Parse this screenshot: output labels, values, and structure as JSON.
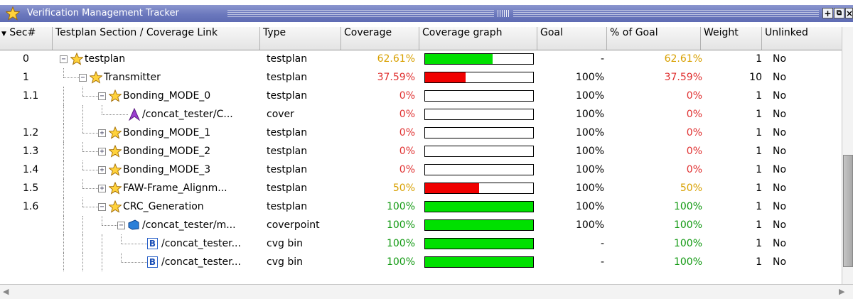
{
  "window": {
    "title": "Verification Management Tracker",
    "buttons": {
      "add": "+",
      "restore": "⧉",
      "close": "×"
    }
  },
  "colors": {
    "title_bar": "#6b78bd",
    "bar_green": "#00e000",
    "bar_red": "#f00000",
    "pct_low": "#e03030",
    "pct_mid": "#d8a000",
    "pct_full": "#119911"
  },
  "table": {
    "columns": [
      "Sec#",
      "Testplan Section / Coverage Link",
      "Type",
      "Coverage",
      "Coverage graph",
      "Goal",
      "% of Goal",
      "Weight",
      "Unlinked"
    ],
    "rows": [
      {
        "sec": "0",
        "name": "testplan",
        "icon": "star-icon",
        "type": "testplan",
        "coverage": "62.61%",
        "coverage_value": 62.61,
        "goal": "-",
        "pct_goal": "62.61%",
        "weight": "1",
        "unlinked": "No",
        "level": "mid",
        "bar": "green"
      },
      {
        "sec": "1",
        "name": "Transmitter",
        "icon": "star-icon",
        "type": "testplan",
        "coverage": "37.59%",
        "coverage_value": 37.59,
        "goal": "100%",
        "pct_goal": "37.59%",
        "weight": "10",
        "unlinked": "No",
        "level": "low",
        "bar": "red"
      },
      {
        "sec": "1.1",
        "name": "Bonding_MODE_0",
        "icon": "star-icon",
        "type": "testplan",
        "coverage": "0%",
        "coverage_value": 0,
        "goal": "100%",
        "pct_goal": "0%",
        "weight": "1",
        "unlinked": "No",
        "level": "low",
        "bar": "red"
      },
      {
        "sec": "",
        "name": "/concat_tester/C...",
        "icon": "cover-icon",
        "type": "cover",
        "coverage": "0%",
        "coverage_value": 0,
        "goal": "100%",
        "pct_goal": "0%",
        "weight": "1",
        "unlinked": "No",
        "level": "low",
        "bar": "red"
      },
      {
        "sec": "1.2",
        "name": "Bonding_MODE_1",
        "icon": "star-icon",
        "type": "testplan",
        "coverage": "0%",
        "coverage_value": 0,
        "goal": "100%",
        "pct_goal": "0%",
        "weight": "1",
        "unlinked": "No",
        "level": "low",
        "bar": "red"
      },
      {
        "sec": "1.3",
        "name": "Bonding_MODE_2",
        "icon": "star-icon",
        "type": "testplan",
        "coverage": "0%",
        "coverage_value": 0,
        "goal": "100%",
        "pct_goal": "0%",
        "weight": "1",
        "unlinked": "No",
        "level": "low",
        "bar": "red"
      },
      {
        "sec": "1.4",
        "name": "Bonding_MODE_3",
        "icon": "star-icon",
        "type": "testplan",
        "coverage": "0%",
        "coverage_value": 0,
        "goal": "100%",
        "pct_goal": "0%",
        "weight": "1",
        "unlinked": "No",
        "level": "low",
        "bar": "red"
      },
      {
        "sec": "1.5",
        "name": "FAW-Frame_Alignm...",
        "icon": "star-icon",
        "type": "testplan",
        "coverage": "50%",
        "coverage_value": 50,
        "goal": "100%",
        "pct_goal": "50%",
        "weight": "1",
        "unlinked": "No",
        "level": "mid",
        "bar": "red"
      },
      {
        "sec": "1.6",
        "name": "CRC_Generation",
        "icon": "star-icon",
        "type": "testplan",
        "coverage": "100%",
        "coverage_value": 100,
        "goal": "100%",
        "pct_goal": "100%",
        "weight": "1",
        "unlinked": "No",
        "level": "full",
        "bar": "green"
      },
      {
        "sec": "",
        "name": "/concat_tester/m...",
        "icon": "coverpoint-icon",
        "type": "coverpoint",
        "coverage": "100%",
        "coverage_value": 100,
        "goal": "100%",
        "pct_goal": "100%",
        "weight": "1",
        "unlinked": "No",
        "level": "full",
        "bar": "green"
      },
      {
        "sec": "",
        "name": "/concat_tester...",
        "icon": "bin-icon",
        "type": "cvg bin",
        "coverage": "100%",
        "coverage_value": 100,
        "goal": "-",
        "pct_goal": "100%",
        "weight": "1",
        "unlinked": "No",
        "level": "full",
        "bar": "green"
      },
      {
        "sec": "",
        "name": "/concat_tester...",
        "icon": "bin-icon",
        "type": "cvg bin",
        "coverage": "100%",
        "coverage_value": 100,
        "goal": "-",
        "pct_goal": "100%",
        "weight": "1",
        "unlinked": "No",
        "level": "full",
        "bar": "green"
      }
    ],
    "bin_letter": "B"
  }
}
